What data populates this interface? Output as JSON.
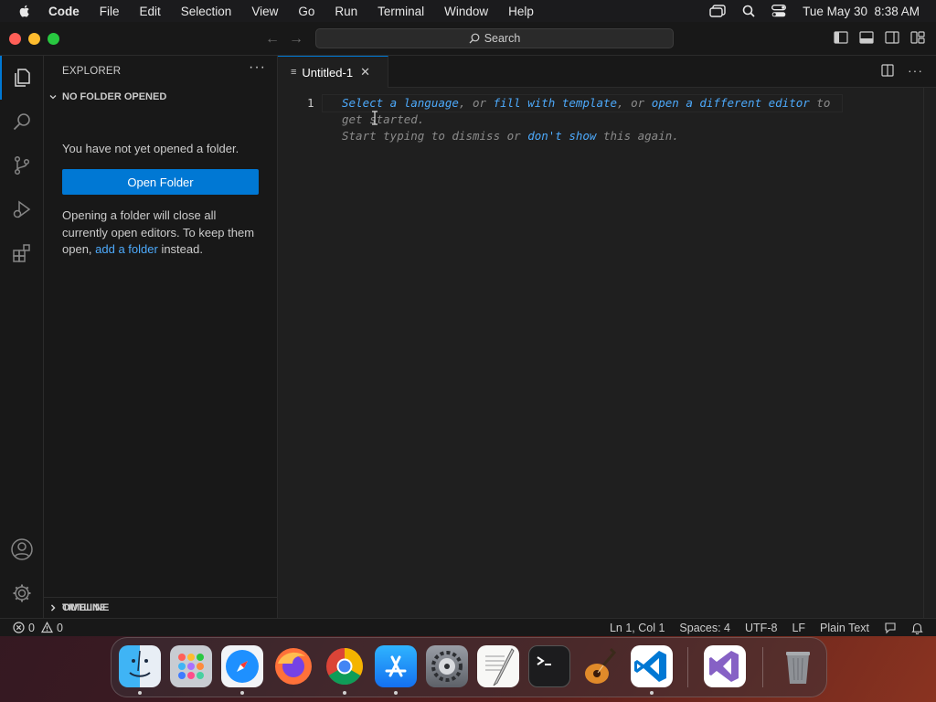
{
  "menubar": {
    "app_name": "Code",
    "items": [
      "File",
      "Edit",
      "Selection",
      "View",
      "Go",
      "Run",
      "Terminal",
      "Window",
      "Help"
    ],
    "datetime": "Tue May 30  8:38 AM"
  },
  "titlebar": {
    "search_label": "Search"
  },
  "sidebar": {
    "title": "EXPLORER",
    "more": "···",
    "section_title": "NO FOLDER OPENED",
    "no_folder_text": "You have not yet opened a folder.",
    "open_folder_label": "Open Folder",
    "info_text_before": "Opening a folder will close all currently open editors. To keep them open, ",
    "info_link": "add a folder",
    "info_text_after": " instead.",
    "outline_label": "OUTLINE",
    "timeline_label": "TIMELINE"
  },
  "editor": {
    "tab_label": "Untitled-1",
    "line_number": "1",
    "hint": {
      "link1": "Select a language",
      "sep1": ", or ",
      "link2": "fill with template",
      "sep2": ", or ",
      "link3": "open a different editor",
      "tail": " to get started.",
      "line2_prefix": "Start typing to dismiss or ",
      "link4": "don't show",
      "line2_suffix": " this again."
    }
  },
  "statusbar": {
    "errors": "0",
    "warnings": "0",
    "position": "Ln 1, Col 1",
    "spaces": "Spaces: 4",
    "encoding": "UTF-8",
    "eol": "LF",
    "language": "Plain Text"
  },
  "dock": {
    "apps": [
      "finder-icon",
      "launchpad-icon",
      "safari-icon",
      "firefox-icon",
      "chrome-icon",
      "app-store-icon",
      "system-settings-icon",
      "textedit-icon",
      "terminal-icon",
      "garageband-icon",
      "vscode-icon",
      "visual-studio-icon",
      "trash-icon"
    ]
  },
  "colors": {
    "accent": "#0078d4",
    "link": "#4daafc",
    "editor_bg": "#1f1f1f",
    "sidebar_bg": "#181818"
  }
}
